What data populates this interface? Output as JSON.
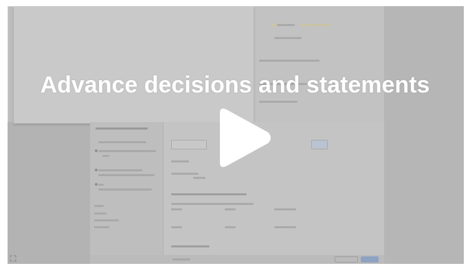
{
  "video": {
    "title": "Advance decisions and statements",
    "play_icon": "play-icon"
  },
  "colors": {
    "overlay_text": "#ffffff",
    "play_button": "#ffffff",
    "background_dim": "#bdbdbd",
    "footer_primary_button": "#8ea3c2"
  }
}
